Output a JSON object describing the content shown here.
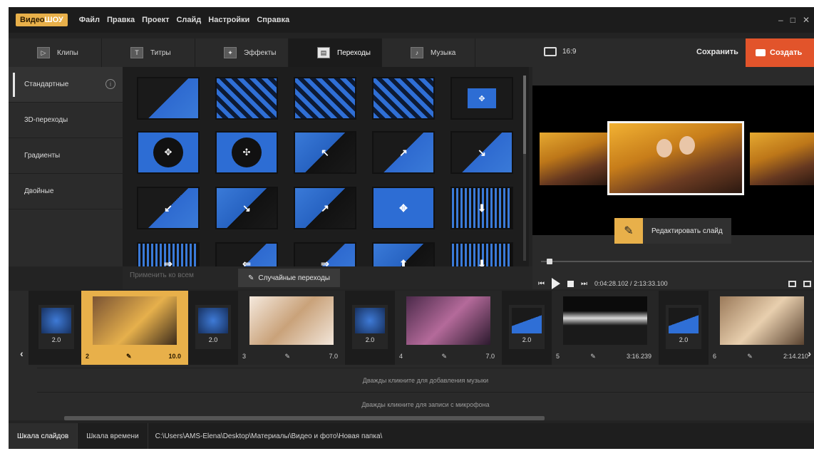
{
  "app": {
    "logo_left": "Видео",
    "logo_right": "ШОУ",
    "menu": [
      "Файл",
      "Правка",
      "Проект",
      "Слайд",
      "Настройки",
      "Справка"
    ]
  },
  "tabs": [
    {
      "label": "Клипы",
      "icon": "clips-icon"
    },
    {
      "label": "Титры",
      "icon": "titles-icon"
    },
    {
      "label": "Эффекты",
      "icon": "effects-icon"
    },
    {
      "label": "Переходы",
      "icon": "transitions-icon",
      "active": true
    },
    {
      "label": "Музыка",
      "icon": "music-icon"
    }
  ],
  "preview_header": {
    "aspect_ratio": "16:9",
    "save_label": "Сохранить",
    "create_label": "Создать"
  },
  "categories": [
    "Стандартные",
    "3D-переходы",
    "Градиенты",
    "Двойные"
  ],
  "transition_actions": {
    "apply_all": "Применить ко всем",
    "random": "Случайные переходы"
  },
  "preview": {
    "edit_slide_label": "Редактировать слайд",
    "time_current": "0:04:28.102",
    "time_total": "2:13:33.100"
  },
  "timeline": {
    "transitions": [
      "2.0",
      "2.0",
      "2.0",
      "2.0",
      "2.0"
    ],
    "slides": [
      {
        "index": "2",
        "duration": "10.0"
      },
      {
        "index": "3",
        "duration": "7.0"
      },
      {
        "index": "4",
        "duration": "7.0"
      },
      {
        "index": "5",
        "duration": "3:16.239"
      },
      {
        "index": "6",
        "duration": "2:14.210"
      }
    ],
    "music_lane": "Дважды кликните для добавления музыки",
    "mic_lane": "Дважды кликните для записи с микрофона"
  },
  "bottom": {
    "tab_slides": "Шкала слайдов",
    "tab_time": "Шкала времени",
    "path": "C:\\Users\\AMS-Elena\\Desktop\\Материалы\\Видео и фото\\Новая папка\\"
  }
}
